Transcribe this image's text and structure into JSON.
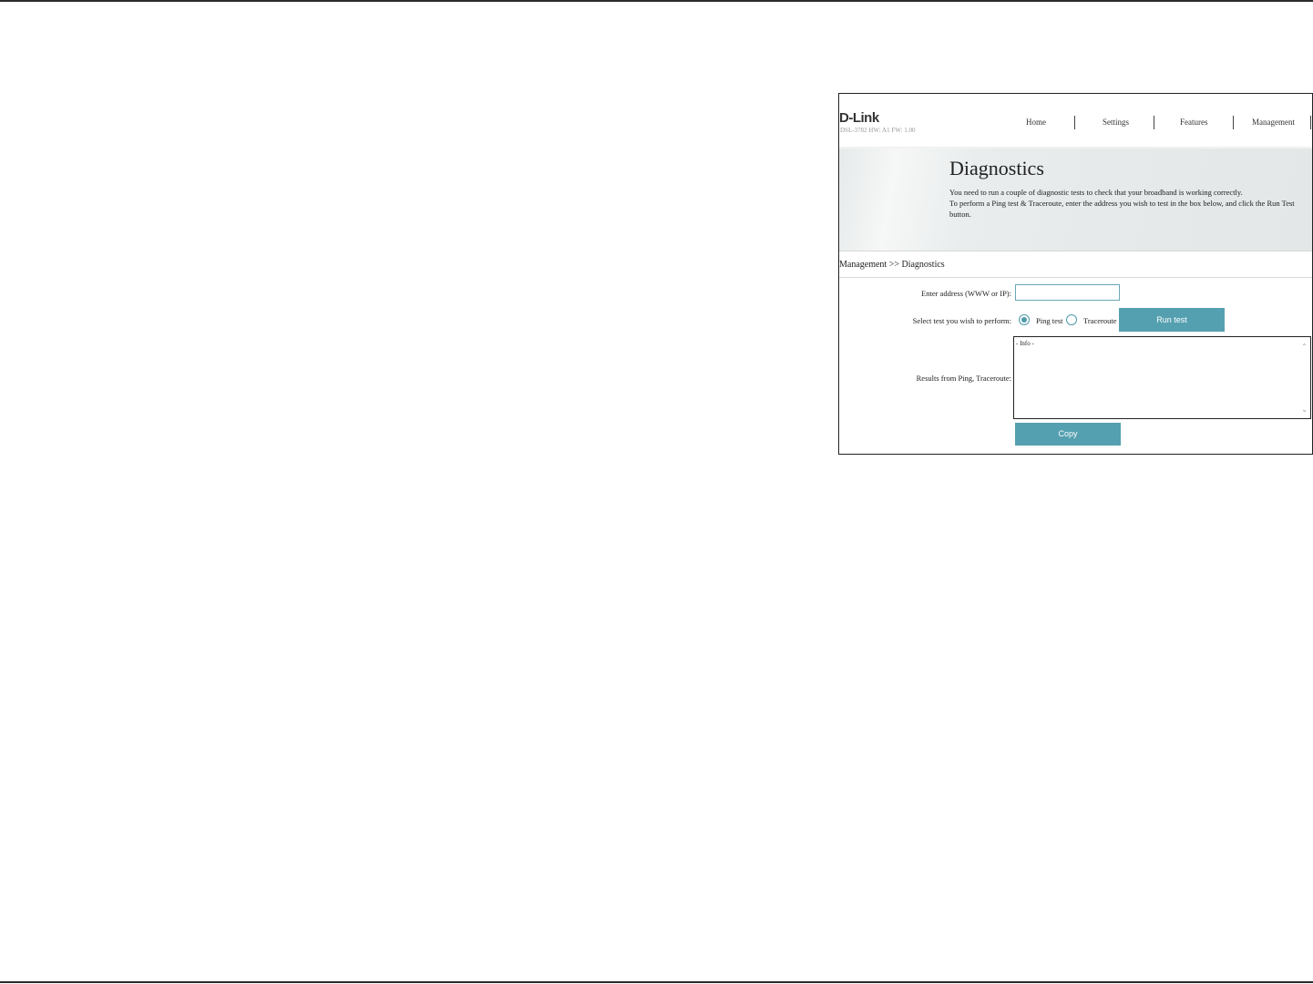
{
  "header": {
    "logo": "D-Link",
    "model": "DSL-3782 HW: A1 FW: 1.00",
    "nav": [
      "Home",
      "Settings",
      "Features",
      "Management"
    ]
  },
  "banner": {
    "title": "Diagnostics",
    "line1": "You need to run a couple of diagnostic tests to check that your broadband is working correctly.",
    "line2": "To perform a Ping test & Traceroute, enter the address you wish to test in the box below, and click the Run Test button."
  },
  "breadcrumb": "Management >> Diagnostics",
  "form": {
    "address_label": "Enter address (WWW or IP):",
    "address_value": "",
    "test_label": "Select test you wish to perform:",
    "ping_label": "Ping test",
    "traceroute_label": "Traceroute",
    "selected_test": "Ping test",
    "run_button": "Run test",
    "results_label": "Results from Ping, Traceroute:",
    "results_text": "- Info -",
    "copy_button": "Copy"
  },
  "colors": {
    "accent": "#55a0b0",
    "banner_bg": "#e6eaea"
  }
}
